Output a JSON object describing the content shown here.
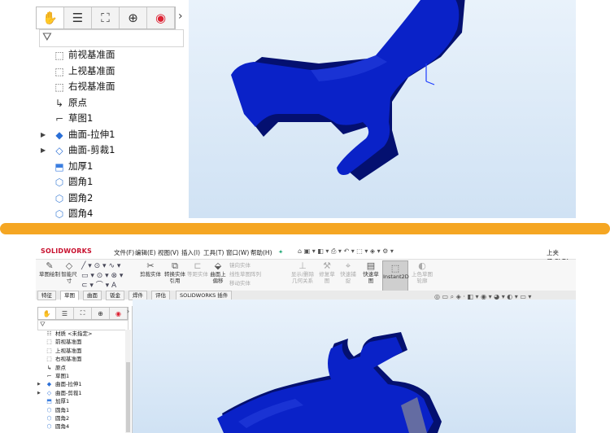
{
  "top_panel": {
    "tree_tabs": [
      "feature-manager-icon",
      "property-manager-icon",
      "configuration-manager-icon",
      "dimxpert-icon",
      "display-manager-icon"
    ],
    "tree_items": [
      {
        "label": "前视基准面",
        "icon": "plane-icon",
        "expandable": false
      },
      {
        "label": "上视基准面",
        "icon": "plane-icon",
        "expandable": false
      },
      {
        "label": "右视基准面",
        "icon": "plane-icon",
        "expandable": false
      },
      {
        "label": "原点",
        "icon": "origin-icon",
        "expandable": false
      },
      {
        "label": "草图1",
        "icon": "sketch-icon",
        "expandable": false
      },
      {
        "label": "曲面-拉伸1",
        "icon": "surface-extrude-icon",
        "expandable": true
      },
      {
        "label": "曲面-剪裁1",
        "icon": "surface-trim-icon",
        "expandable": true
      },
      {
        "label": "加厚1",
        "icon": "thicken-icon",
        "expandable": false
      },
      {
        "label": "圆角1",
        "icon": "fillet-icon",
        "expandable": false
      },
      {
        "label": "圆角2",
        "icon": "fillet-icon",
        "expandable": false
      },
      {
        "label": "圆角4",
        "icon": "fillet-icon",
        "expandable": false
      }
    ]
  },
  "colors": {
    "accent": "#f5a623",
    "part_blue": "#0a22c8",
    "part_dark": "#041070",
    "viewport_top": "#e9f2fb",
    "viewport_bottom": "#d0e2f4"
  },
  "bottom_panel": {
    "logo": "SOLIDWORKS",
    "menu": [
      "文件(F)",
      "编辑(E)",
      "视图(V)",
      "插入(I)",
      "工具(T)",
      "窗口(W)",
      "帮助(H)"
    ],
    "doc_title": "上夹子.SLDI",
    "ribbon": {
      "sketch_btn": "草图绘制",
      "smart_dim": "智能尺寸",
      "offset_entity": "等距实体",
      "convert_entity": "转换实体引用",
      "offset_surface": "曲面上偏移",
      "mirror_entity": "镜向实体",
      "linear_pattern": "线性草图阵列",
      "move_entity": "移动实体",
      "show_delete": "显示/删除几何关系",
      "repair_sketch": "修复草图",
      "quick_snap": "快速捕捉",
      "quick_view": "快速草图",
      "instant2d": "Instant2D",
      "shaded_sketch": "上色草图轮廓",
      "trim_entity": "剪裁实体"
    },
    "cmd_tabs": [
      "特征",
      "草图",
      "曲面",
      "钣金",
      "焊件",
      "评估",
      "SOLIDWORKS 插件"
    ],
    "active_tab": "草图",
    "tree_items": [
      {
        "label": "材质 <未指定>",
        "icon": "material-icon",
        "expandable": false
      },
      {
        "label": "前视基准面",
        "icon": "plane-icon",
        "expandable": false
      },
      {
        "label": "上视基准面",
        "icon": "plane-icon",
        "expandable": false
      },
      {
        "label": "右视基准面",
        "icon": "plane-icon",
        "expandable": false
      },
      {
        "label": "原点",
        "icon": "origin-icon",
        "expandable": false
      },
      {
        "label": "草图1",
        "icon": "sketch-icon",
        "expandable": false
      },
      {
        "label": "曲面-拉伸1",
        "icon": "surface-extrude-icon",
        "expandable": true
      },
      {
        "label": "曲面-剪裁1",
        "icon": "surface-trim-icon",
        "expandable": true
      },
      {
        "label": "加厚1",
        "icon": "thicken-icon",
        "expandable": false
      },
      {
        "label": "圆角1",
        "icon": "fillet-icon",
        "expandable": false
      },
      {
        "label": "圆角2",
        "icon": "fillet-icon",
        "expandable": false
      },
      {
        "label": "圆角4",
        "icon": "fillet-icon",
        "expandable": false
      }
    ]
  }
}
